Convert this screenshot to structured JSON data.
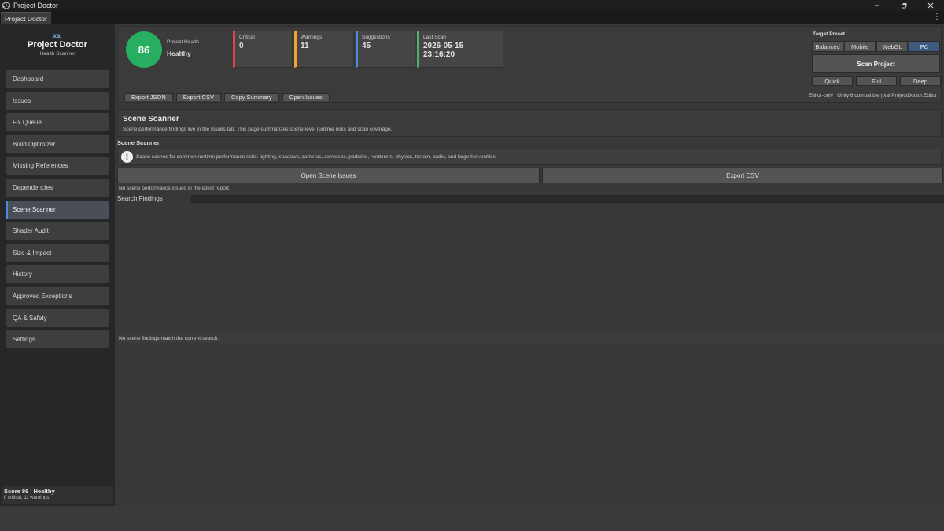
{
  "window": {
    "title": "Project Doctor",
    "icon": "unity-icon"
  },
  "tabbar": {
    "active_tab": "Project Doctor"
  },
  "sidebar": {
    "brand_small": "xal",
    "brand_title": "Project Doctor",
    "brand_sub": "Health Scanner",
    "items": [
      {
        "label": "Dashboard"
      },
      {
        "label": "Issues"
      },
      {
        "label": "Fix Queue"
      },
      {
        "label": "Build Optimizer"
      },
      {
        "label": "Missing References"
      },
      {
        "label": "Dependencies"
      },
      {
        "label": "Scene Scanner"
      },
      {
        "label": "Shader Audit"
      },
      {
        "label": "Size & Impact"
      },
      {
        "label": "History"
      },
      {
        "label": "Approved Exceptions"
      },
      {
        "label": "QA & Safety"
      },
      {
        "label": "Settings"
      }
    ],
    "active_item": "Scene Scanner",
    "footer": {
      "score_line": "Score 86 | Healthy",
      "sub_line": "0 critical, 11 warnings"
    }
  },
  "health": {
    "score": "86",
    "label": "Project Health",
    "status": "Healthy",
    "color": "#27ae60"
  },
  "stats": {
    "critical": {
      "label": "Critical",
      "value": "0",
      "color": "#d9474b"
    },
    "warnings": {
      "label": "Warnings",
      "value": "11",
      "color": "#f0a330"
    },
    "suggestions": {
      "label": "Suggestions",
      "value": "45",
      "color": "#4b8be0"
    },
    "last_scan": {
      "label": "Last Scan",
      "date": "2026-05-15",
      "time": "23:16:20",
      "color": "#4fb06b"
    }
  },
  "actions": {
    "export_json": "Export JSON",
    "export_csv": "Export CSV",
    "copy_summary": "Copy Summary",
    "open_issues": "Open Issues"
  },
  "preset": {
    "title": "Target Preset",
    "options": [
      "Balanced",
      "Mobile",
      "WebGL",
      "PC"
    ],
    "selected": "PC",
    "scan_button": "Scan Project",
    "depth_options": [
      "Quick",
      "Full",
      "Deep"
    ],
    "editor_info": "Editor-only | Unity 6 compatible | xal.ProjectDoctor.Editor"
  },
  "page": {
    "title": "Scene Scanner",
    "description": "Scene performance findings live in the Issues tab. This page summarizes scene-level runtime risks and scan coverage.",
    "section_label": "Scene Scanner",
    "info_text": "Scans scenes for common runtime performance risks: lighting, shadows, cameras, canvases, particles, renderers, physics, terrain, audio, and large hierarchies.",
    "open_scene_issues": "Open Scene Issues",
    "export_csv": "Export CSV",
    "status_line": "No scene performance issues in the latest report.",
    "search_label": "Search Findings",
    "search_value": "",
    "empty_message": "No scene findings match the current search."
  },
  "colors": {
    "accent": "#4b8be0",
    "selected_preset": "#3e5b7e"
  }
}
